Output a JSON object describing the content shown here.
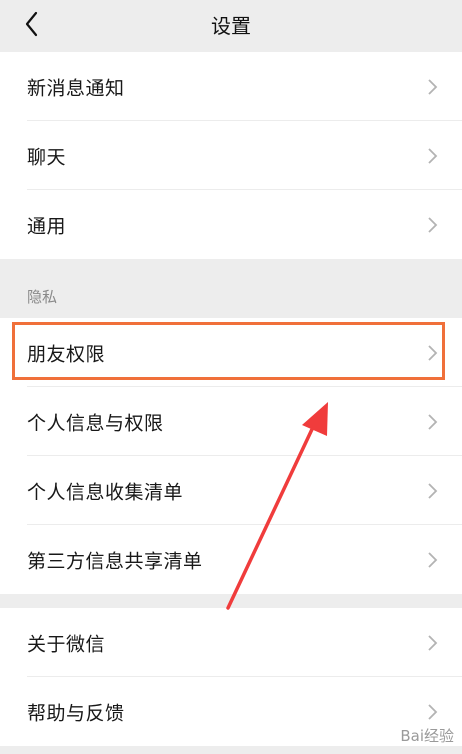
{
  "header": {
    "title": "设置",
    "back_icon": "chevron-left-icon"
  },
  "groups": [
    {
      "items": [
        {
          "label": "新消息通知"
        },
        {
          "label": "聊天"
        },
        {
          "label": "通用"
        }
      ]
    },
    {
      "items": [
        {
          "label": "朋友权限"
        },
        {
          "label": "个人信息与权限"
        },
        {
          "label": "个人信息收集清单"
        },
        {
          "label": "第三方信息共享清单"
        }
      ]
    },
    {
      "items": [
        {
          "label": "关于微信"
        },
        {
          "label": "帮助与反馈"
        }
      ]
    }
  ],
  "section": {
    "privacy_label": "隐私"
  },
  "annotation": {
    "highlight_color": "#f0703a",
    "arrow_color": "#f03c3c"
  },
  "watermark": {
    "text": "Bai经验"
  }
}
